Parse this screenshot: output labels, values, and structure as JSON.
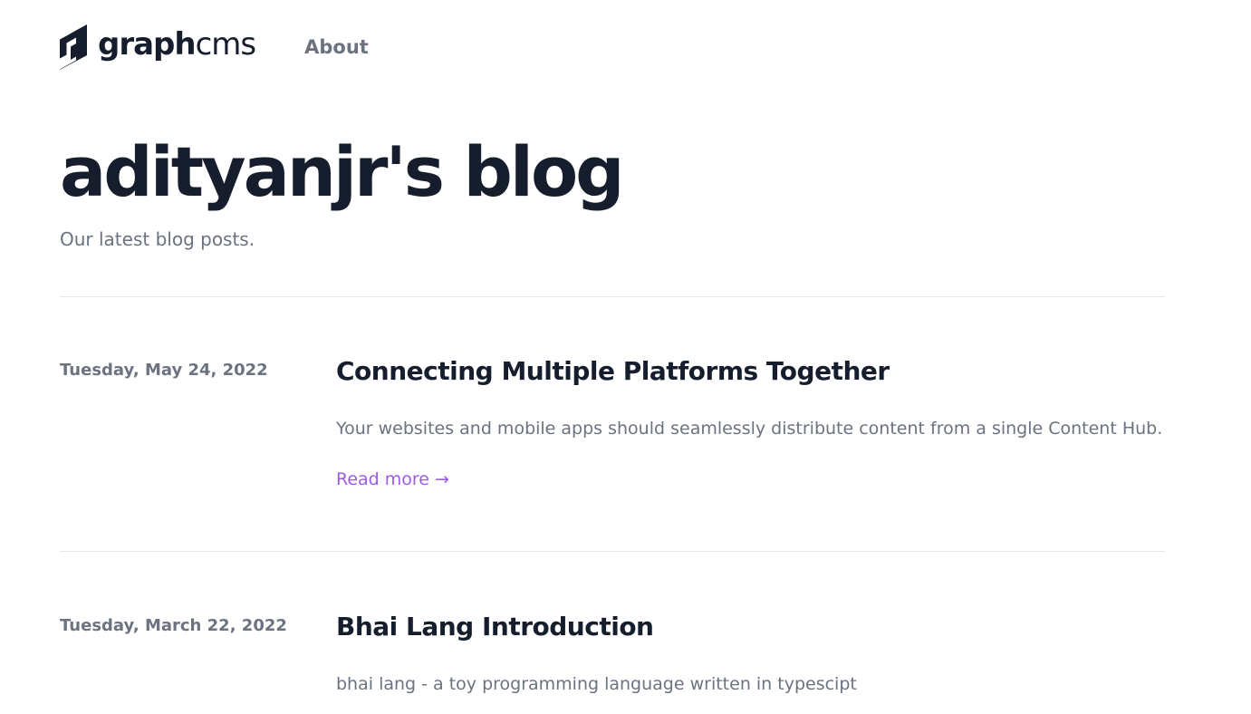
{
  "header": {
    "logo": {
      "graph": "graph",
      "cms": "cms"
    },
    "nav": {
      "about_label": "About"
    }
  },
  "hero": {
    "title": "adityanjr's blog",
    "subtitle": "Our latest blog posts."
  },
  "posts": [
    {
      "date": "Tuesday, May 24, 2022",
      "title": "Connecting Multiple Platforms Together",
      "excerpt": "Your websites and mobile apps should seamlessly distribute content from a single Content Hub.",
      "read_more": "Read more →"
    },
    {
      "date": "Tuesday, March 22, 2022",
      "title": "Bhai Lang Introduction",
      "excerpt": "bhai lang - a toy programming language written in typescipt"
    }
  ],
  "colors": {
    "heading": "#161e2e",
    "muted": "#6b7280",
    "accent": "#9b5de5",
    "divider": "#e5e7eb"
  },
  "icons": {
    "logo": "graphcms-logo-icon"
  }
}
